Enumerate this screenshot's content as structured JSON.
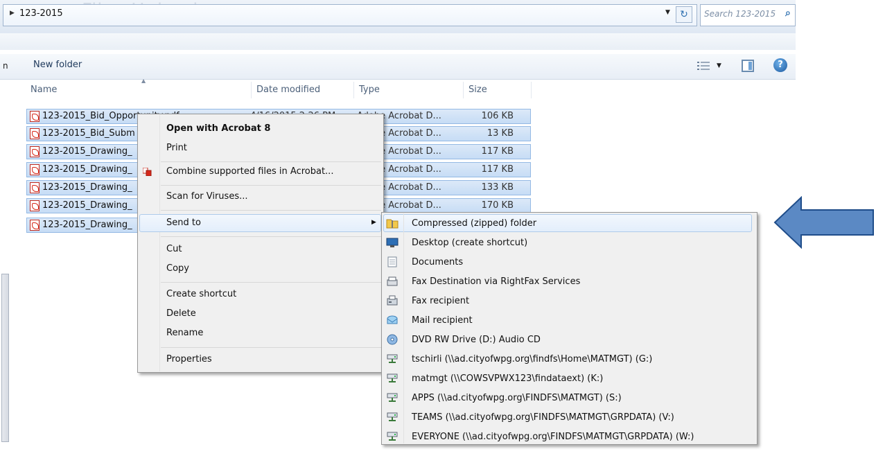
{
  "address": {
    "path": "123-2015",
    "ghost_title": "Files Upload",
    "search_placeholder": "Search 123-2015"
  },
  "toolbar": {
    "cut_fragment": "n",
    "new_folder_label": "New folder"
  },
  "columns": {
    "name": "Name",
    "date_modified": "Date modified",
    "type": "Type",
    "size": "Size"
  },
  "files": [
    {
      "name": "123-2015_Bid_Opportunity.pdf",
      "date": "4/16/2015 2:26 PM",
      "type": "Adobe Acrobat D...",
      "size": "106 KB"
    },
    {
      "name": "123-2015_Bid_Subm",
      "date": "",
      "type": "Adobe Acrobat D...",
      "size": "13 KB"
    },
    {
      "name": "123-2015_Drawing_",
      "date": "",
      "type": "Adobe Acrobat D...",
      "size": "117 KB"
    },
    {
      "name": "123-2015_Drawing_",
      "date": "",
      "type": "Adobe Acrobat D...",
      "size": "117 KB"
    },
    {
      "name": "123-2015_Drawing_",
      "date": "",
      "type": "Adobe Acrobat D...",
      "size": "133 KB"
    },
    {
      "name": "123-2015_Drawing_",
      "date": "",
      "type": "Adobe Acrobat D...",
      "size": "170 KB"
    },
    {
      "name": "123-2015_Drawing_",
      "date": "",
      "type": "",
      "size": ""
    }
  ],
  "context_menu": {
    "open": "Open with Acrobat 8",
    "print": "Print",
    "combine": "Combine supported files in Acrobat...",
    "scan": "Scan for Viruses...",
    "send_to": "Send to",
    "cut": "Cut",
    "copy": "Copy",
    "create_shortcut": "Create shortcut",
    "delete": "Delete",
    "rename": "Rename",
    "properties": "Properties"
  },
  "send_to_menu": [
    {
      "label": "Compressed (zipped) folder",
      "icon": "zip-folder-icon"
    },
    {
      "label": "Desktop (create shortcut)",
      "icon": "desktop-icon"
    },
    {
      "label": "Documents",
      "icon": "documents-icon"
    },
    {
      "label": "Fax Destination via RightFax Services",
      "icon": "fax-destination-icon"
    },
    {
      "label": "Fax recipient",
      "icon": "fax-recipient-icon"
    },
    {
      "label": "Mail recipient",
      "icon": "mail-recipient-icon"
    },
    {
      "label": "DVD RW Drive (D:) Audio CD",
      "icon": "dvd-drive-icon"
    },
    {
      "label": "tschirli (\\\\ad.cityofwpg.org\\findfs\\Home\\MATMGT) (G:)",
      "icon": "network-drive-icon"
    },
    {
      "label": "matmgt (\\\\COWSVPWX123\\findataext) (K:)",
      "icon": "network-drive-icon"
    },
    {
      "label": "APPS (\\\\ad.cityofwpg.org\\FINDFS\\MATMGT) (S:)",
      "icon": "network-drive-icon"
    },
    {
      "label": "TEAMS (\\\\ad.cityofwpg.org\\FINDFS\\MATMGT\\GRPDATA) (V:)",
      "icon": "network-drive-icon"
    },
    {
      "label": "EVERYONE (\\\\ad.cityofwpg.org\\FINDFS\\MATMGT\\GRPDATA) (W:)",
      "icon": "network-drive-icon"
    }
  ],
  "colors": {
    "selection_fill": "#c6dcf5",
    "arrow_fill": "#5b89c4",
    "arrow_stroke": "#1f4d8a"
  }
}
